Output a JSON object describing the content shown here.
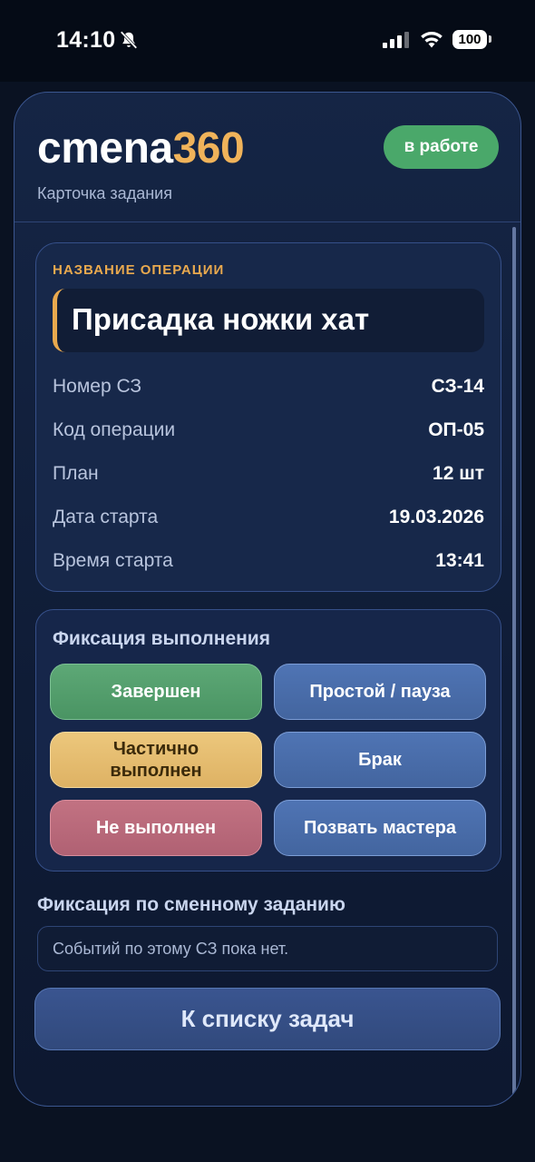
{
  "status_bar": {
    "time": "14:10",
    "battery": "100",
    "icons": [
      "bell-off-icon",
      "signal-icon",
      "wifi-icon",
      "battery-icon"
    ]
  },
  "header": {
    "logo_main": "cmena",
    "logo_accent": "360",
    "subtitle": "Карточка задания",
    "status": "в работе"
  },
  "operation": {
    "caption": "НАЗВАНИЕ ОПЕРАЦИИ",
    "name": "Присадка ножки хат",
    "rows": [
      {
        "label": "Номер СЗ",
        "value": "СЗ-14"
      },
      {
        "label": "Код операции",
        "value": "ОП-05"
      },
      {
        "label": "План",
        "value": "12 шт"
      },
      {
        "label": "Дата старта",
        "value": "19.03.2026"
      },
      {
        "label": "Время старта",
        "value": "13:41"
      }
    ]
  },
  "fixation": {
    "title": "Фиксация выполнения",
    "buttons": {
      "completed": "Завершен",
      "downtime": "Простой / пауза",
      "partial_line1": "Частично",
      "partial_line2": "выполнен",
      "defect": "Брак",
      "not_done": "Не выполнен",
      "call_master": "Позвать мастера"
    }
  },
  "shift": {
    "title": "Фиксация по сменному заданию",
    "empty_text": "Событий по этому СЗ пока нет."
  },
  "back_button": "К списку задач",
  "colors": {
    "accent": "#f0b35a",
    "status_green": "#4aa86a",
    "button_blue": "#4f74b4",
    "button_yellow": "#deb264",
    "button_red": "#b06173"
  }
}
